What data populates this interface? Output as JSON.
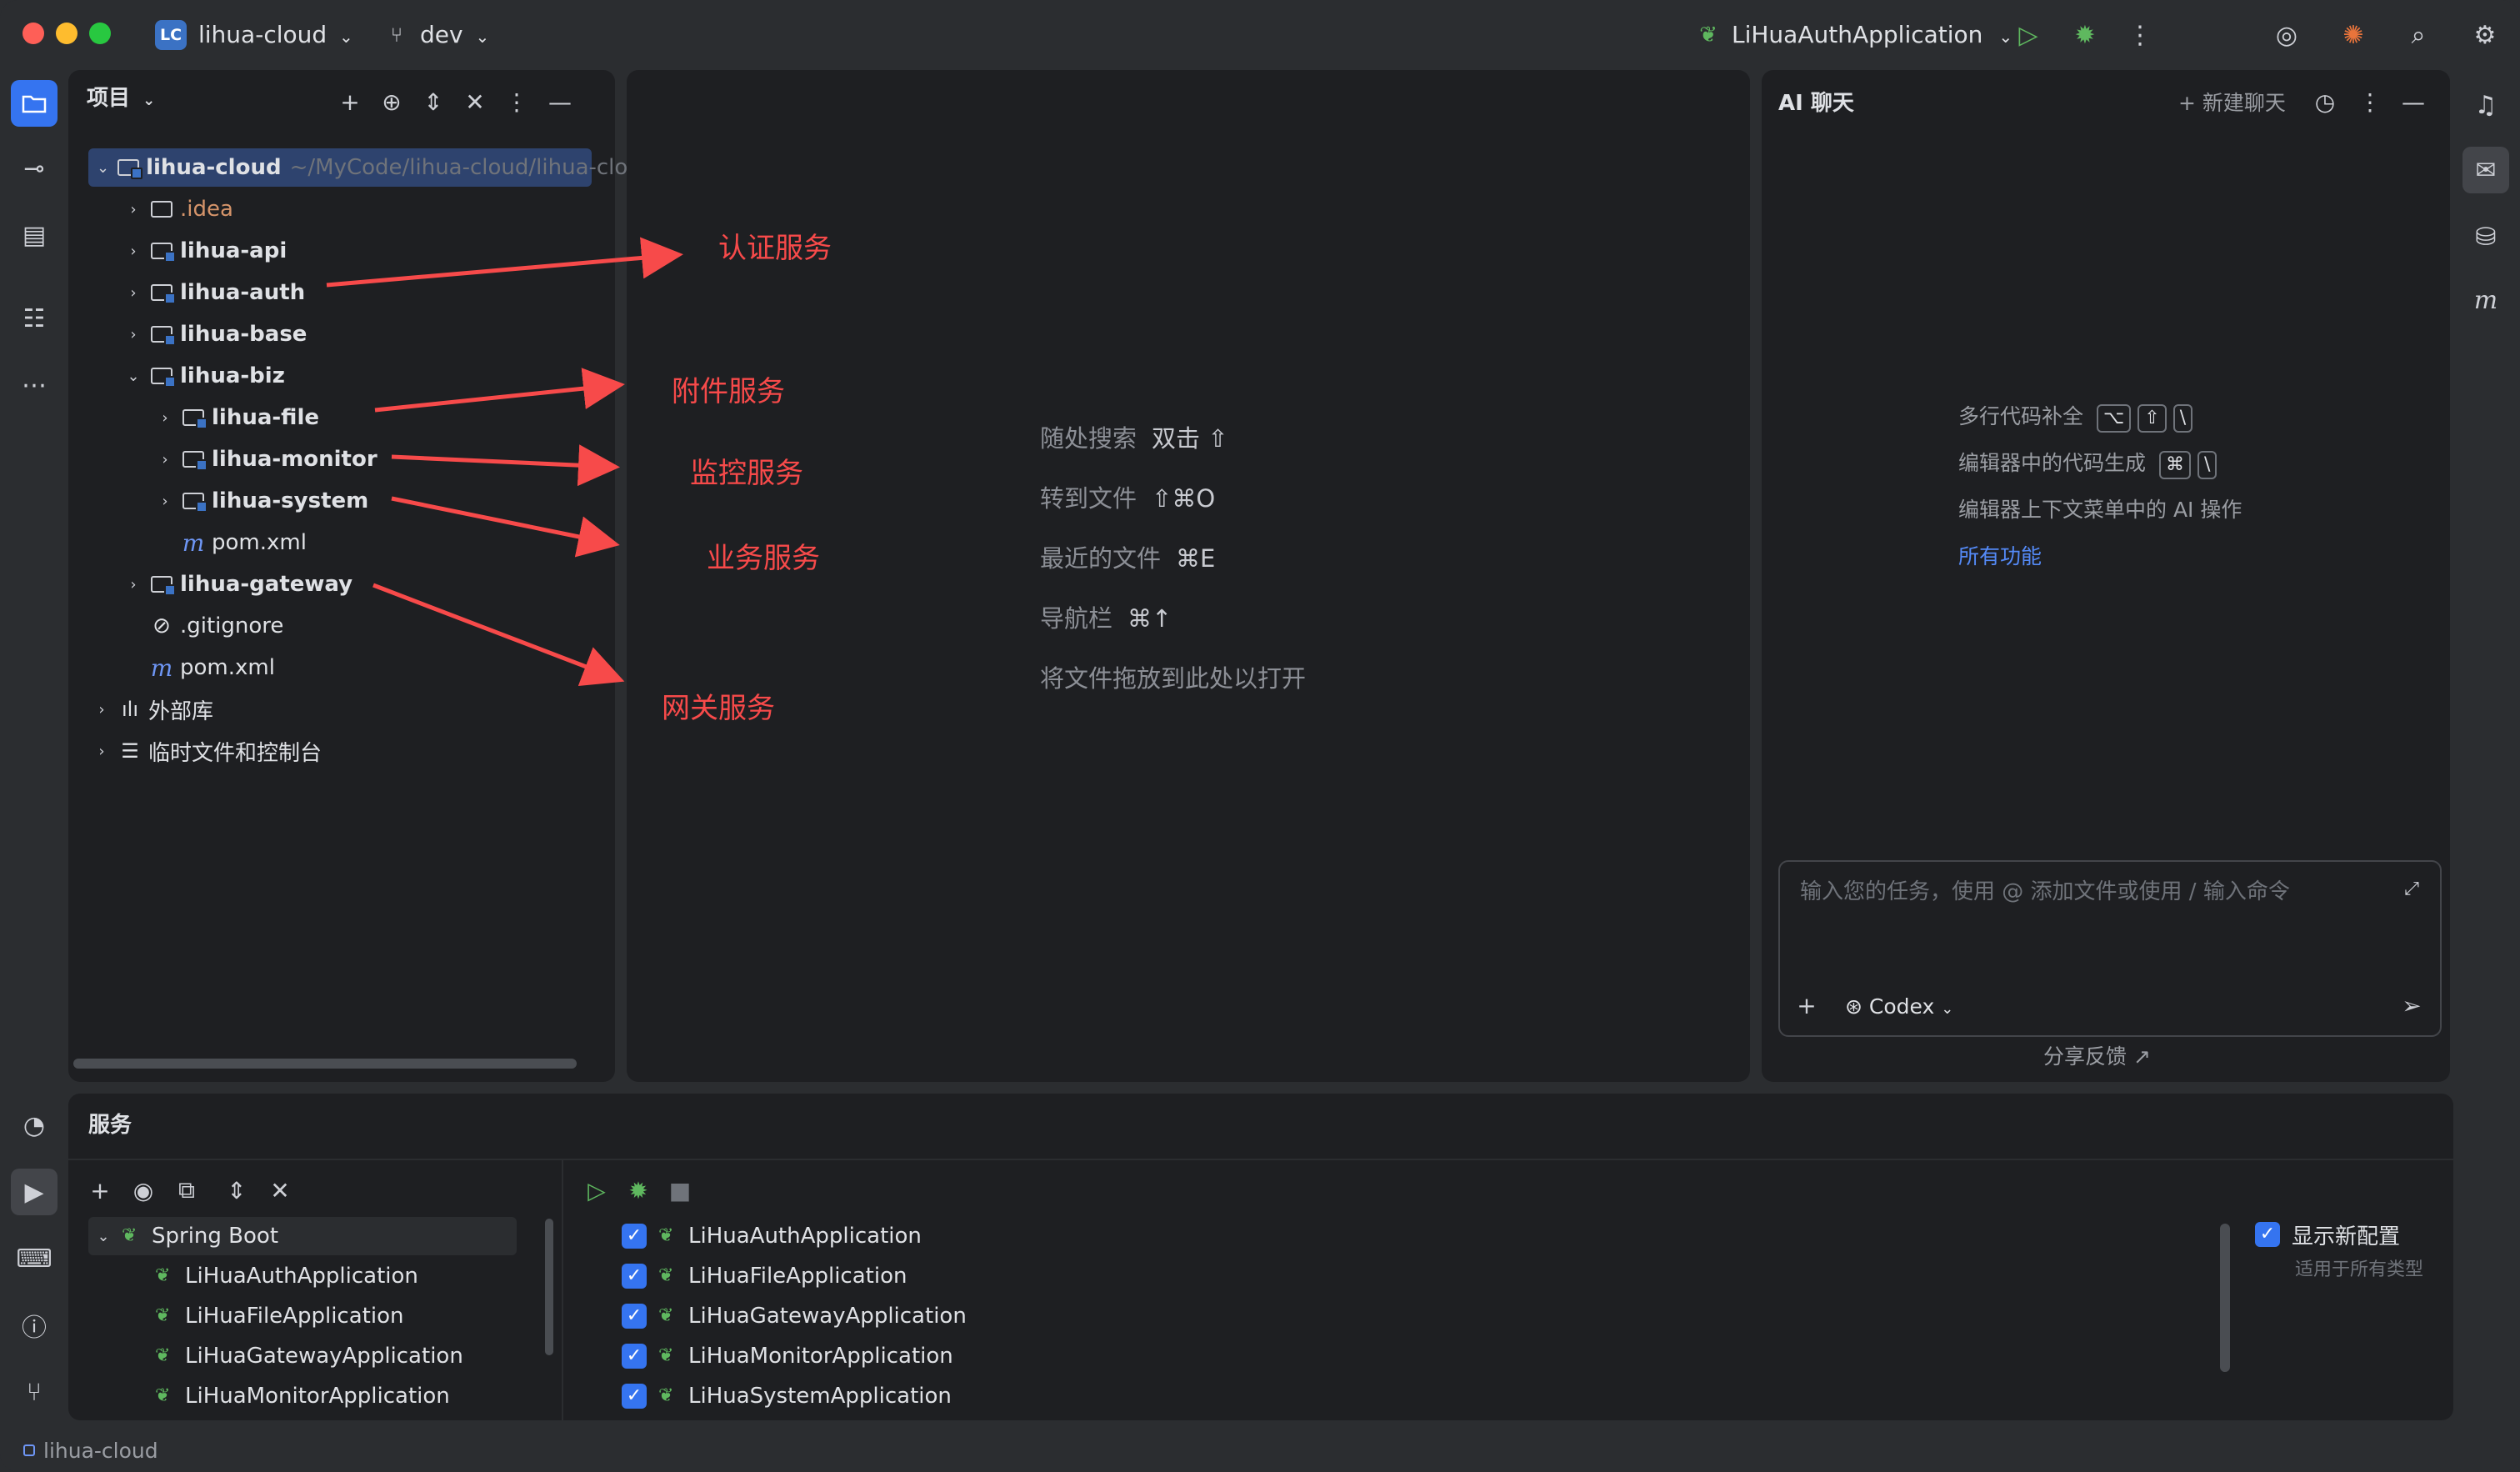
{
  "titlebar": {
    "project_badge": "LC",
    "project_name": "lihua-cloud",
    "branch": "dev",
    "run_config": "LiHuaAuthApplication"
  },
  "project_panel": {
    "title": "项目",
    "tree": [
      {
        "label": "lihua-cloud",
        "path": "~/MyCode/lihua-cloud/lihua-cloud"
      },
      {
        "label": ".idea"
      },
      {
        "label": "lihua-api"
      },
      {
        "label": "lihua-auth"
      },
      {
        "label": "lihua-base"
      },
      {
        "label": "lihua-biz"
      },
      {
        "label": "lihua-file"
      },
      {
        "label": "lihua-monitor"
      },
      {
        "label": "lihua-system"
      },
      {
        "label": "pom.xml"
      },
      {
        "label": "lihua-gateway"
      },
      {
        "label": ".gitignore"
      },
      {
        "label": "pom.xml"
      },
      {
        "label": "外部库"
      },
      {
        "label": "临时文件和控制台"
      }
    ]
  },
  "annotations": {
    "auth": "认证服务",
    "file": "附件服务",
    "monitor": "监控服务",
    "system": "业务服务",
    "gateway": "网关服务",
    "color": "#f74a4a"
  },
  "editor_hints": [
    {
      "label": "随处搜索",
      "key": "双击 ⇧"
    },
    {
      "label": "转到文件",
      "key": "⇧⌘O"
    },
    {
      "label": "最近的文件",
      "key": "⌘E"
    },
    {
      "label": "导航栏",
      "key": "⌘↑"
    },
    {
      "label": "将文件拖放到此处以打开",
      "key": ""
    }
  ],
  "ai_panel": {
    "title": "AI 聊天",
    "new_chat": "新建聊天",
    "feature1": "多行代码补全",
    "feature1_keys": [
      "⌥",
      "⇧",
      "\\"
    ],
    "feature2": "编辑器中的代码生成",
    "feature2_keys": [
      "⌘",
      "\\"
    ],
    "feature3": "编辑器上下文菜单中的 AI 操作",
    "all_features": "所有功能",
    "input_placeholder": "输入您的任务，使用 @ 添加文件或使用 / 输入命令",
    "model": "Codex",
    "feedback": "分享反馈 ↗"
  },
  "services_panel": {
    "title": "服务",
    "group": "Spring Boot",
    "left_items": [
      "LiHuaAuthApplication",
      "LiHuaFileApplication",
      "LiHuaGatewayApplication",
      "LiHuaMonitorApplication"
    ],
    "right_items": [
      "LiHuaAuthApplication",
      "LiHuaFileApplication",
      "LiHuaGatewayApplication",
      "LiHuaMonitorApplication",
      "LiHuaSystemApplication"
    ],
    "show_new_config": "显示新配置",
    "applies_all": "适用于所有类型"
  },
  "statusbar": {
    "project": "lihua-cloud"
  }
}
